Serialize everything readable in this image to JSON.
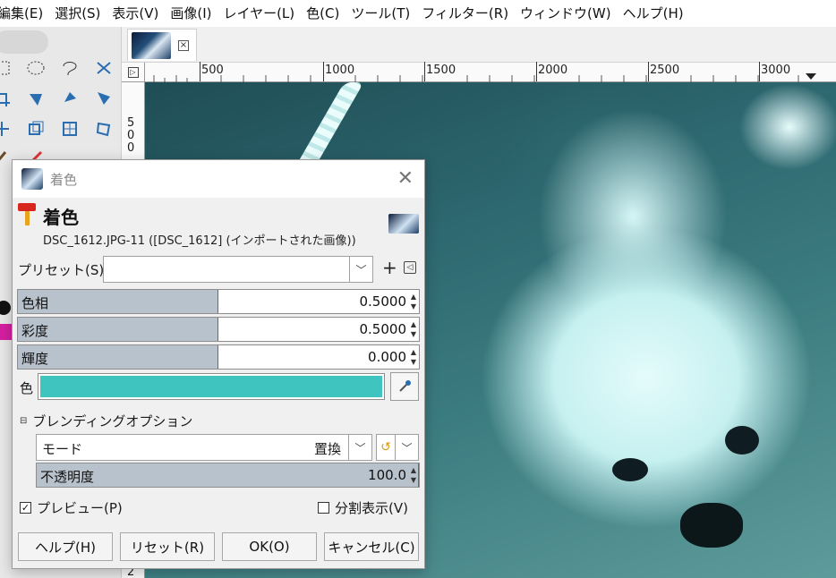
{
  "menubar": {
    "items": [
      "編集(E)",
      "選択(S)",
      "表示(V)",
      "画像(I)",
      "レイヤー(L)",
      "色(C)",
      "ツール(T)",
      "フィルター(R)",
      "ウィンドウ(W)",
      "ヘルプ(H)"
    ]
  },
  "ruler": {
    "top_labels": [
      "500",
      "1000",
      "1500",
      "2000",
      "2500",
      "3000"
    ],
    "left_labels": [
      "5",
      "0",
      "0",
      "2"
    ]
  },
  "colors": {
    "accent_cyan": "#40c4c0",
    "slider_fill": "#b8c2cc"
  },
  "dialog": {
    "window_title": "着色",
    "title": "着色",
    "subtitle": "DSC_1612.JPG-11 ([DSC_1612] (インポートされた画像))",
    "preset": {
      "label": "プリセット(S):",
      "value": "",
      "add": "+",
      "menu": "◁"
    },
    "sliders": [
      {
        "label": "色相",
        "value": "0.5000",
        "fraction": 0.5
      },
      {
        "label": "彩度",
        "value": "0.5000",
        "fraction": 0.5
      },
      {
        "label": "輝度",
        "value": "0.000",
        "fraction": 0.5
      }
    ],
    "color": {
      "label": "色",
      "hex": "#40c4c0"
    },
    "blending": {
      "header": "ブレンディングオプション",
      "mode_label": "モード",
      "mode_value": "置換",
      "opacity_label": "不透明度",
      "opacity_value": "100.0",
      "opacity_fraction": 1.0
    },
    "preview": {
      "label": "プレビュー(P)",
      "checked": true
    },
    "split": {
      "label": "分割表示(V)",
      "checked": false
    },
    "buttons": {
      "help": "ヘルプ(H)",
      "reset": "リセット(R)",
      "ok": "OK(O)",
      "cancel": "キャンセル(C)"
    }
  }
}
